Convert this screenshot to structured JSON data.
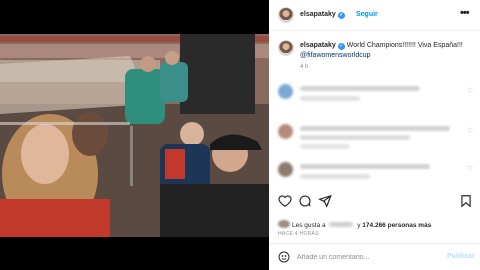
{
  "post": {
    "username": "elsapataky",
    "follow_label": "Seguir",
    "more_label": "•••",
    "caption_user": "elsapataky",
    "caption_text": " World Champions!!!!!!! Viva España!!! ",
    "caption_tag": "@fifawomensworldcup",
    "caption_time": "4 h",
    "likes_prefix": "Les gusta a ",
    "likes_connector": " y ",
    "likes_count": "174.266 personas más",
    "time_ago": "HACE 4 HORAS"
  },
  "icons": {
    "verified": "verified-badge-icon",
    "like": "heart-icon",
    "comment": "comment-bubble-icon",
    "share": "paper-plane-icon",
    "save": "bookmark-icon",
    "emoji": "smiley-icon"
  },
  "composer": {
    "placeholder": "Añade un comentario...",
    "publish_label": "Publicar"
  },
  "colors": {
    "link_blue": "#0095f6",
    "verified_blue": "#3897f0",
    "publish_disabled": "#b2dffc",
    "muted_gray": "#8e8e8e"
  }
}
